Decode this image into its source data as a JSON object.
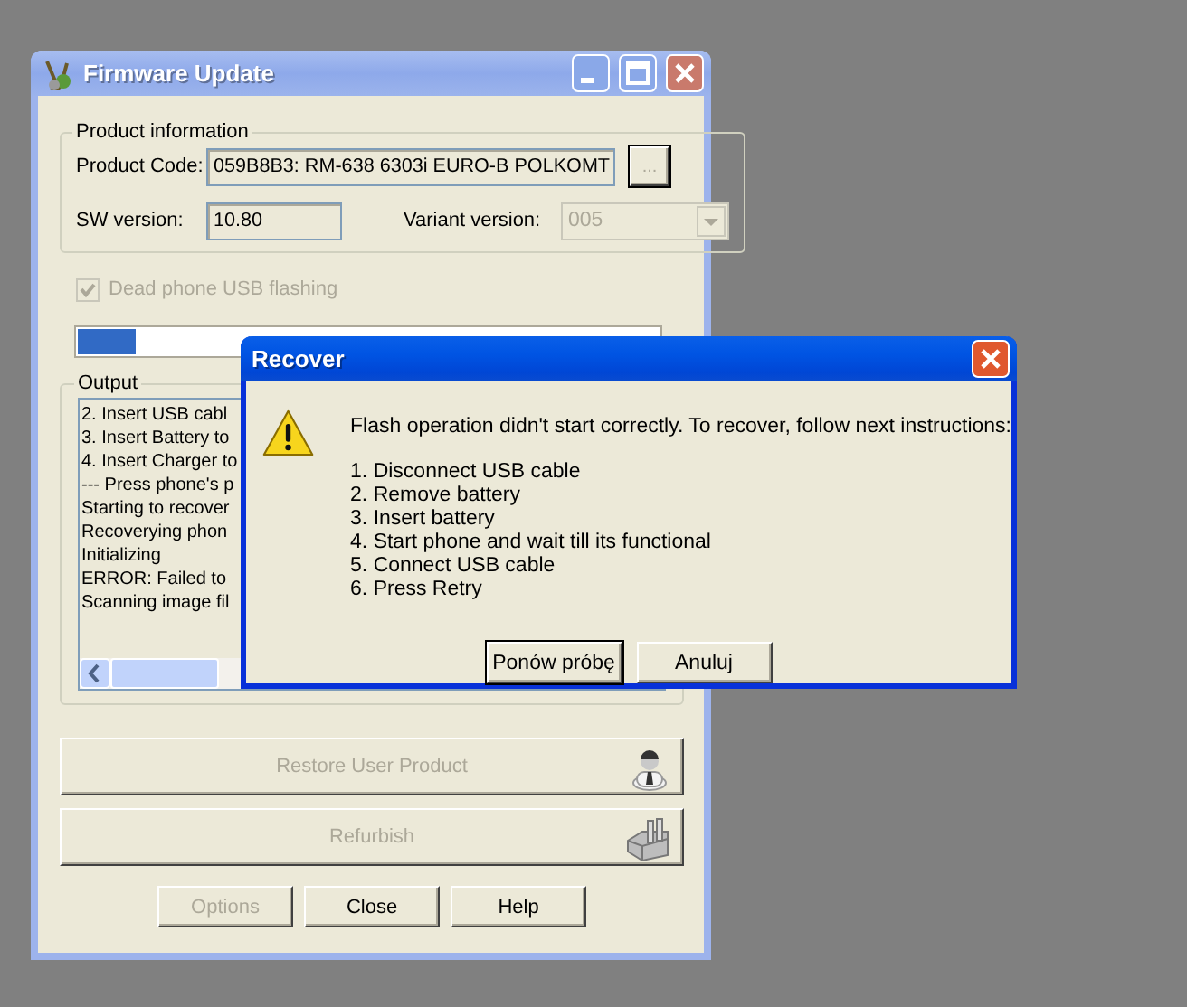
{
  "main_window": {
    "title": "Firmware Update",
    "product_information": {
      "title": "Product information",
      "product_code_label": "Product Code:",
      "product_code": "059B8B3: RM-638 6303i EURO-B POLKOMT",
      "browse_button": "...",
      "sw_version_label": "SW version:",
      "sw_version": "10.80",
      "variant_version_label": "Variant version:",
      "variant_version": "005",
      "variant_disabled": true
    },
    "dead_phone_checkbox": {
      "label": "Dead phone USB flashing",
      "checked": true,
      "disabled": true
    },
    "progress": {
      "level": 0.1
    },
    "output": {
      "title": "Output",
      "lines": [
        "2. Insert USB cabl",
        "3. Insert Battery to",
        "4. Insert Charger to",
        "--- Press phone's p",
        "Starting to recover",
        "Recoverying phon",
        "Initializing",
        "ERROR: Failed to",
        "Scanning image fil"
      ]
    },
    "action_buttons": [
      {
        "label": "Restore User Product",
        "disabled": true,
        "kind": "person"
      },
      {
        "label": "Refurbish",
        "disabled": true,
        "kind": "machine"
      }
    ],
    "buttons": [
      {
        "label": "Options",
        "disabled": true
      },
      {
        "label": "Close",
        "disabled": false
      },
      {
        "label": "Help",
        "disabled": false
      }
    ]
  },
  "dialog": {
    "title": "Recover",
    "message": "Flash operation didn't start correctly. To recover, follow next instructions:",
    "steps": [
      "1. Disconnect USB cable",
      "2. Remove battery",
      "3. Insert battery",
      "4. Start phone and wait till its functional",
      "5. Connect USB cable",
      "6. Press Retry"
    ],
    "buttons": [
      {
        "label": "Ponów próbę",
        "default": true
      },
      {
        "label": "Anuluj",
        "default": false
      }
    ]
  }
}
